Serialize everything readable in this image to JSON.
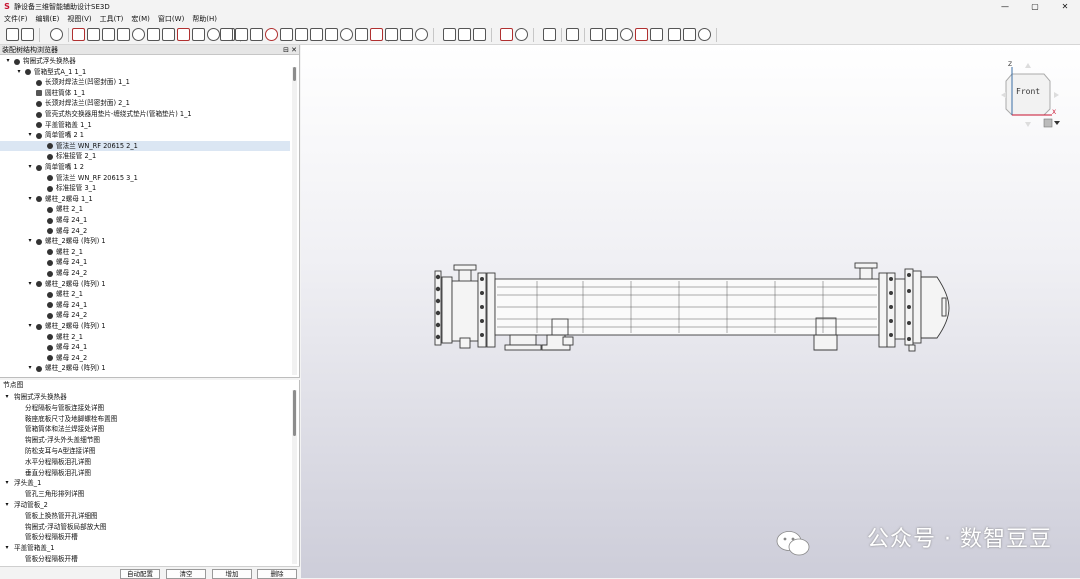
{
  "window": {
    "title": "静设备三维智能辅助设计SE3D",
    "minimize": "—",
    "maximize": "▢",
    "close": "✕"
  },
  "menu": [
    "文件(F)",
    "编辑(E)",
    "视图(V)",
    "工具(T)",
    "宏(M)",
    "窗口(W)",
    "帮助(H)"
  ],
  "tree_panel": {
    "title": "装配树结构浏览器",
    "pin": "⊟",
    "close": "✕",
    "rows": [
      {
        "label": "钩圈式浮头换热器",
        "lvl": 0,
        "tw": "▾",
        "icon": "assembly-icon"
      },
      {
        "label": "管箱型式A_1 1_1",
        "lvl": 1,
        "tw": "▾",
        "icon": "assembly-icon"
      },
      {
        "label": "长颈对焊法兰(凹密封面) 1_1",
        "lvl": 2,
        "tw": "",
        "icon": "part-icon"
      },
      {
        "label": "圆柱筒体 1_1",
        "lvl": 2,
        "tw": "",
        "icon": "cylinder-icon"
      },
      {
        "label": "长颈对焊法兰(凹密封面) 2_1",
        "lvl": 2,
        "tw": "",
        "icon": "part-icon"
      },
      {
        "label": "管壳式热交换器用垫片-缠绕式垫片(管箱垫片) 1_1",
        "lvl": 2,
        "tw": "",
        "icon": "part-icon"
      },
      {
        "label": "平盖管箱盖 1_1",
        "lvl": 2,
        "tw": "",
        "icon": "part-icon"
      },
      {
        "label": "简单管嘴 2 1",
        "lvl": 2,
        "tw": "▾",
        "icon": "assembly-icon"
      },
      {
        "label": "管法兰 WN_RF 20615 2_1",
        "lvl": 3,
        "tw": "",
        "icon": "part-icon",
        "sel": true
      },
      {
        "label": "标准接管 2_1",
        "lvl": 3,
        "tw": "",
        "icon": "part-icon"
      },
      {
        "label": "简单管嘴 1 2",
        "lvl": 2,
        "tw": "▾",
        "icon": "assembly-icon"
      },
      {
        "label": "管法兰 WN_RF 20615 3_1",
        "lvl": 3,
        "tw": "",
        "icon": "part-icon"
      },
      {
        "label": "标准接管 3_1",
        "lvl": 3,
        "tw": "",
        "icon": "part-icon"
      },
      {
        "label": "螺柱_2螺母 1_1",
        "lvl": 2,
        "tw": "▾",
        "icon": "assembly-icon"
      },
      {
        "label": "螺柱 2_1",
        "lvl": 3,
        "tw": "",
        "icon": "part-icon"
      },
      {
        "label": "螺母 24_1",
        "lvl": 3,
        "tw": "",
        "icon": "part-icon"
      },
      {
        "label": "螺母 24_2",
        "lvl": 3,
        "tw": "",
        "icon": "part-icon"
      },
      {
        "label": "螺柱_2螺母 (阵列) 1",
        "lvl": 2,
        "tw": "▾",
        "icon": "assembly-icon"
      },
      {
        "label": "螺柱 2_1",
        "lvl": 3,
        "tw": "",
        "icon": "part-icon"
      },
      {
        "label": "螺母 24_1",
        "lvl": 3,
        "tw": "",
        "icon": "part-icon"
      },
      {
        "label": "螺母 24_2",
        "lvl": 3,
        "tw": "",
        "icon": "part-icon"
      },
      {
        "label": "螺柱_2螺母 (阵列) 1",
        "lvl": 2,
        "tw": "▾",
        "icon": "assembly-icon"
      },
      {
        "label": "螺柱 2_1",
        "lvl": 3,
        "tw": "",
        "icon": "part-icon"
      },
      {
        "label": "螺母 24_1",
        "lvl": 3,
        "tw": "",
        "icon": "part-icon"
      },
      {
        "label": "螺母 24_2",
        "lvl": 3,
        "tw": "",
        "icon": "part-icon"
      },
      {
        "label": "螺柱_2螺母 (阵列) 1",
        "lvl": 2,
        "tw": "▾",
        "icon": "assembly-icon"
      },
      {
        "label": "螺柱 2_1",
        "lvl": 3,
        "tw": "",
        "icon": "part-icon"
      },
      {
        "label": "螺母 24_1",
        "lvl": 3,
        "tw": "",
        "icon": "part-icon"
      },
      {
        "label": "螺母 24_2",
        "lvl": 3,
        "tw": "",
        "icon": "part-icon"
      },
      {
        "label": "螺柱_2螺母 (阵列) 1",
        "lvl": 2,
        "tw": "▾",
        "icon": "assembly-icon"
      }
    ]
  },
  "detail_panel": {
    "title": "节点图",
    "rows": [
      {
        "label": "钩圈式浮头换热器",
        "lvl": 0,
        "tw": "▾"
      },
      {
        "label": "分程隔板与管板连接处详图",
        "lvl": 1,
        "tw": ""
      },
      {
        "label": "鞍座底板尺寸及地脚螺栓布置图",
        "lvl": 1,
        "tw": ""
      },
      {
        "label": "管箱筒体和法兰焊接处详图",
        "lvl": 1,
        "tw": ""
      },
      {
        "label": "钩圈式-浮头外头盖细节图",
        "lvl": 1,
        "tw": ""
      },
      {
        "label": "防松支耳与A型连接详图",
        "lvl": 1,
        "tw": ""
      },
      {
        "label": "水平分程隔板泪孔详图",
        "lvl": 1,
        "tw": ""
      },
      {
        "label": "垂直分程隔板泪孔详图",
        "lvl": 1,
        "tw": ""
      },
      {
        "label": "浮头盖_1",
        "lvl": 0,
        "tw": "▾"
      },
      {
        "label": "管孔三角形排列详图",
        "lvl": 1,
        "tw": ""
      },
      {
        "label": "浮动管板_2",
        "lvl": 0,
        "tw": "▾"
      },
      {
        "label": "管板上换热管开孔详细图",
        "lvl": 1,
        "tw": ""
      },
      {
        "label": "钩圈式-浮动管板局部放大图",
        "lvl": 1,
        "tw": ""
      },
      {
        "label": "管板分程隔板开槽",
        "lvl": 1,
        "tw": ""
      },
      {
        "label": "平盖管箱盖_1",
        "lvl": 0,
        "tw": "▾"
      },
      {
        "label": "管板分程隔板开槽",
        "lvl": 1,
        "tw": ""
      }
    ]
  },
  "buttons": [
    "自动配置",
    "清空",
    "增加",
    "删除"
  ],
  "viewcube": {
    "face": "Front",
    "axis_z": "Z",
    "axis_x": "X"
  },
  "watermark": "公众号 · 数智豆豆",
  "colors": {
    "accent": "#c8102e",
    "selection": "#dbe6f3",
    "model": "#777777"
  }
}
